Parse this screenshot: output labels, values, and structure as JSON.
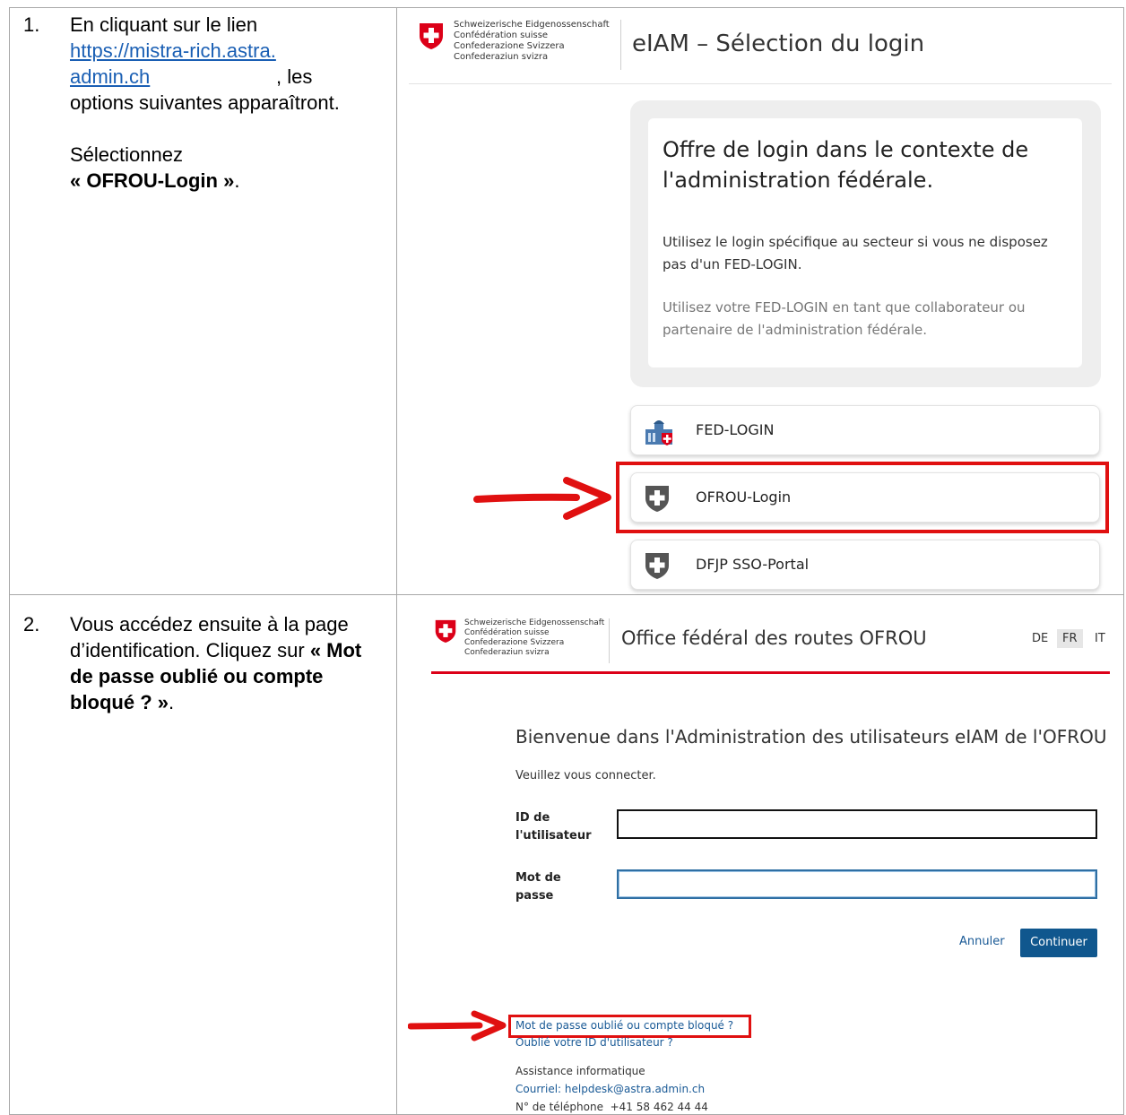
{
  "steps": [
    {
      "number": "1.",
      "text_before_link": "En cliquant sur le lien",
      "link": "https://mistra-rich.astra.admin.ch",
      "text_after_link": ", les options suivantes apparaîtront.",
      "select_prefix": "Sélectionnez",
      "select_bold": "« OFROU-Login »",
      "select_suffix": "."
    },
    {
      "number": "2.",
      "text_plain": "Vous accédez ensuite à la page d’identification. Cliquez sur ",
      "text_bold": "« Mot de passe oublié ou compte bloqué ? »",
      "text_suffix": "."
    }
  ],
  "confederation": [
    "Schweizerische Eidgenossenschaft",
    "Confédération suisse",
    "Confederazione Svizzera",
    "Confederaziun svizra"
  ],
  "screen1": {
    "title": "eIAM – Sélection du login",
    "card_heading": "Offre de login dans le contexte de l'administration fédérale.",
    "card_p1": "Utilisez le login spécifique au secteur si vous ne disposez pas d'un FED-LOGIN.",
    "card_p2": "Utilisez votre FED-LOGIN en tant que collaborateur ou partenaire de l'administration fédérale.",
    "options": [
      {
        "label": "FED-LOGIN",
        "icon": "federal-palace-icon"
      },
      {
        "label": "OFROU-Login",
        "icon": "swiss-shield-icon"
      },
      {
        "label": "DFJP SSO-Portal",
        "icon": "swiss-shield-icon"
      }
    ]
  },
  "screen2": {
    "title": "Office fédéral des routes OFROU",
    "languages": [
      "DE",
      "FR",
      "IT"
    ],
    "active_language": "FR",
    "welcome": "Bienvenue dans l'Administration des utilisateurs eIAM de l'OFROU",
    "please_login": "Veuillez vous connecter.",
    "user_id_label": "ID de l'utilisateur",
    "password_label": "Mot de passe",
    "cancel": "Annuler",
    "continue": "Continuer",
    "forgot_password": "Mot de passe oublié ou compte bloqué ?",
    "forgot_id": "Oublié votre ID d'utilisateur ?",
    "support_title": "Assistance informatique",
    "support_email": "Courriel: helpdesk@astra.admin.ch",
    "support_phone": "N° de téléphone  +41 58 462 44 44"
  },
  "colors": {
    "swiss_red": "#dc0018",
    "highlight_red": "#e01010",
    "link_blue": "#1a5fb4",
    "button_blue": "#10578e"
  }
}
